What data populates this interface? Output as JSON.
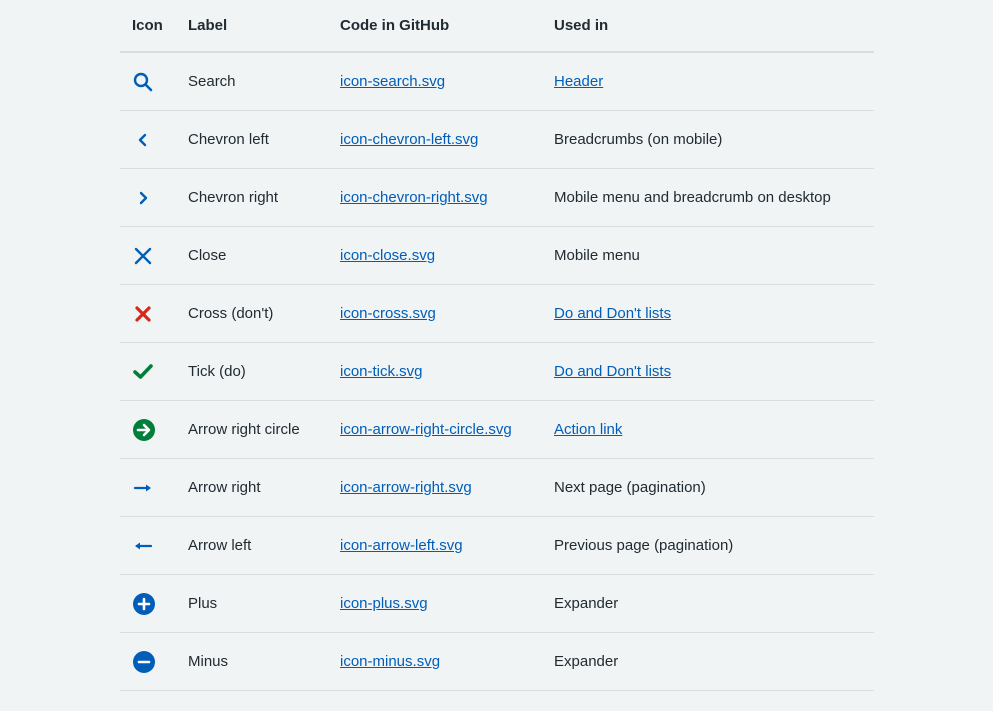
{
  "table": {
    "headers": {
      "icon": "Icon",
      "label": "Label",
      "code": "Code in GitHub",
      "used": "Used in"
    },
    "rows": [
      {
        "icon": "search-icon",
        "label": "Search",
        "code": "icon-search.svg",
        "used": "Header",
        "used_link": true
      },
      {
        "icon": "chevron-left-icon",
        "label": "Chevron left",
        "code": "icon-chevron-left.svg",
        "used": "Breadcrumbs (on mobile)",
        "used_link": false
      },
      {
        "icon": "chevron-right-icon",
        "label": "Chevron right",
        "code": "icon-chevron-right.svg",
        "used": "Mobile menu and breadcrumb on desktop",
        "used_link": false
      },
      {
        "icon": "close-icon",
        "label": "Close",
        "code": "icon-close.svg",
        "used": "Mobile menu",
        "used_link": false
      },
      {
        "icon": "cross-icon",
        "label": "Cross (don't)",
        "code": "icon-cross.svg",
        "used": "Do and Don't lists",
        "used_link": true
      },
      {
        "icon": "tick-icon",
        "label": "Tick (do)",
        "code": "icon-tick.svg",
        "used": "Do and Don't lists",
        "used_link": true
      },
      {
        "icon": "arrow-right-circle-icon",
        "label": "Arrow right circle",
        "code": "icon-arrow-right-circle.svg",
        "used": "Action link",
        "used_link": true
      },
      {
        "icon": "arrow-right-icon",
        "label": "Arrow right",
        "code": "icon-arrow-right.svg",
        "used": "Next page (pagination)",
        "used_link": false
      },
      {
        "icon": "arrow-left-icon",
        "label": "Arrow left",
        "code": "icon-arrow-left.svg",
        "used": "Previous page (pagination)",
        "used_link": false
      },
      {
        "icon": "plus-icon",
        "label": "Plus",
        "code": "icon-plus.svg",
        "used": "Expander",
        "used_link": false
      },
      {
        "icon": "minus-icon",
        "label": "Minus",
        "code": "icon-minus.svg",
        "used": "Expander",
        "used_link": false
      }
    ]
  },
  "colors": {
    "blue": "#005eb8",
    "red": "#d5281b",
    "green": "#007f3b",
    "text": "#212b32",
    "background": "#f0f4f5",
    "border": "#d8dde0"
  }
}
